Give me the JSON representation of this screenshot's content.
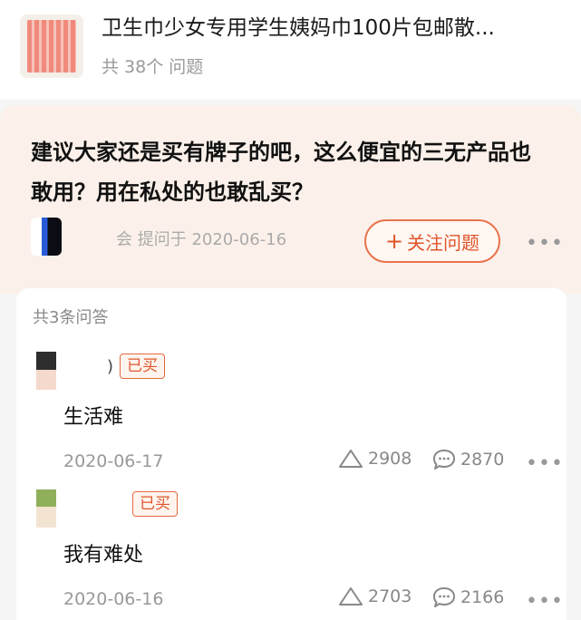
{
  "product": {
    "title": "卫生巾少女专用学生姨妈巾100片包邮散...",
    "question_count": "共 38个 问题",
    "thumbnail_icon": "product-image-icon"
  },
  "question": {
    "text": "建议大家还是买有牌子的吧，这么便宜的三无产品也敢用？用在私处的也敢乱买？",
    "asker_prefix": "会",
    "asked_meta": "提问于 2020-06-16",
    "follow_plus": "+",
    "follow_label": "关注问题",
    "more": "•••"
  },
  "answers": {
    "count_label": "共3条问答",
    "items": [
      {
        "nickname": ")",
        "badge": "已买",
        "text": "生活难",
        "date": "2020-06-17",
        "likes": "2908",
        "comments": "2870",
        "more": "•••"
      },
      {
        "nickname": "",
        "badge": "已买",
        "text": "我有难处",
        "date": "2020-06-16",
        "likes": "2703",
        "comments": "2166",
        "more": "•••"
      }
    ]
  },
  "colors": {
    "accent": "#e0552c",
    "question_bg": "#fbf1ea",
    "muted": "#999999"
  },
  "icons": [
    "like-triangle-icon",
    "comment-bubble-icon",
    "more-dots-icon",
    "plus-icon"
  ]
}
